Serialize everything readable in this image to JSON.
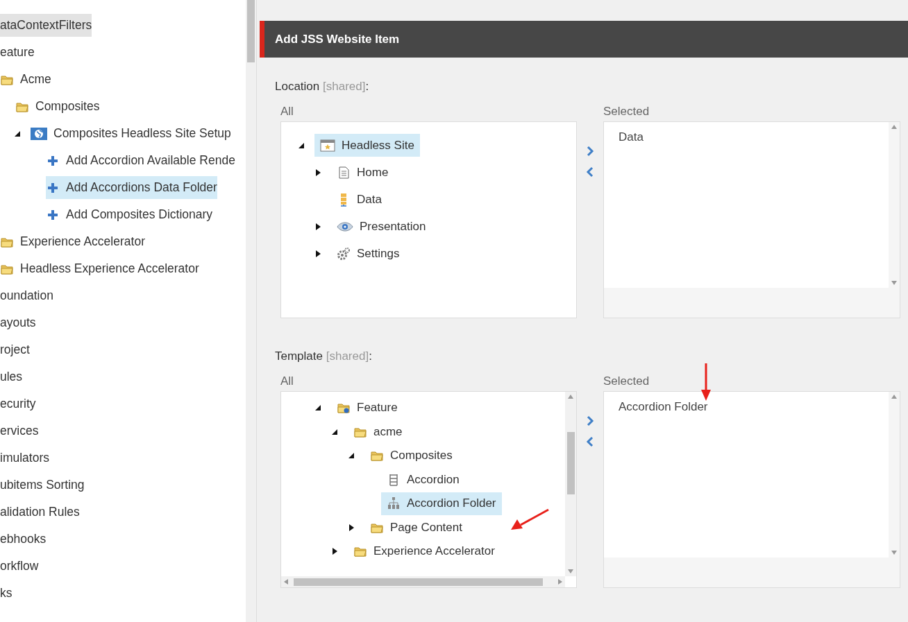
{
  "sidebar": {
    "tree": [
      {
        "label": "ataContextFilters",
        "selected": false,
        "hovered": true
      },
      {
        "label": "eature",
        "selected": false,
        "hovered": false,
        "children": [
          {
            "label": "Acme",
            "kind": "folder",
            "selected": false,
            "hovered": false,
            "children": [
              {
                "label": "Composites",
                "kind": "folder",
                "selected": false,
                "hovered": false,
                "children": [
                  {
                    "label": "Composites Headless Site Setup",
                    "kind": "globe",
                    "expanded": true,
                    "selected": false,
                    "hovered": false,
                    "children": [
                      {
                        "label": "Add Accordion Available Rende",
                        "kind": "plus",
                        "selected": false,
                        "hovered": false
                      },
                      {
                        "label": "Add Accordions Data Folder",
                        "kind": "plus",
                        "selected": true,
                        "hovered": false
                      },
                      {
                        "label": "Add Composites Dictionary",
                        "kind": "plus",
                        "selected": false,
                        "hovered": false
                      }
                    ]
                  }
                ]
              }
            ]
          },
          {
            "label": "Experience Accelerator",
            "kind": "folder",
            "selected": false,
            "hovered": false
          },
          {
            "label": "Headless Experience Accelerator",
            "kind": "folder",
            "selected": false,
            "hovered": false
          }
        ]
      },
      {
        "label": "oundation",
        "selected": false,
        "hovered": false
      },
      {
        "label": "ayouts",
        "selected": false,
        "hovered": false
      },
      {
        "label": "roject",
        "selected": false,
        "hovered": false
      },
      {
        "label": "ules",
        "selected": false,
        "hovered": false
      },
      {
        "label": "ecurity",
        "selected": false,
        "hovered": false
      },
      {
        "label": "ervices",
        "selected": false,
        "hovered": false
      },
      {
        "label": "imulators",
        "selected": false,
        "hovered": false
      },
      {
        "label": "ubitems Sorting",
        "selected": false,
        "hovered": false
      },
      {
        "label": "alidation Rules",
        "selected": false,
        "hovered": false
      },
      {
        "label": "ebhooks",
        "selected": false,
        "hovered": false
      },
      {
        "label": "orkflow",
        "selected": false,
        "hovered": false
      },
      {
        "label": "ks",
        "selected": false,
        "hovered": false
      }
    ]
  },
  "dialog": {
    "title": "Add JSS Website Item",
    "fields": [
      {
        "label": "Location",
        "note": "[shared]",
        "suffix": ":",
        "all_label": "All",
        "selected_label": "Selected",
        "tree": [
          {
            "label": "Headless Site",
            "kind": "site",
            "expanded": true,
            "selected": true,
            "children": [
              {
                "label": "Home",
                "kind": "page",
                "expanded": false,
                "selected": false
              },
              {
                "label": "Data",
                "kind": "data",
                "selected": false
              },
              {
                "label": "Presentation",
                "kind": "eye",
                "expanded": false,
                "selected": false
              },
              {
                "label": "Settings",
                "kind": "gear",
                "expanded": false,
                "selected": false
              }
            ]
          }
        ],
        "selected_items": [
          "Data"
        ]
      },
      {
        "label": "Template",
        "note": "[shared]",
        "suffix": ":",
        "all_label": "All",
        "selected_label": "Selected",
        "tree": [
          {
            "label": "Feature",
            "kind": "featurefolder",
            "expanded": true,
            "selected": false,
            "children": [
              {
                "label": "acme",
                "kind": "folder",
                "expanded": true,
                "selected": false,
                "children": [
                  {
                    "label": "Composites",
                    "kind": "folder",
                    "expanded": true,
                    "selected": false,
                    "children": [
                      {
                        "label": "Accordion",
                        "kind": "template",
                        "selected": false
                      },
                      {
                        "label": "Accordion Folder",
                        "kind": "hierarchy",
                        "selected": true
                      }
                    ]
                  },
                  {
                    "label": "Page Content",
                    "kind": "folder",
                    "expanded": false,
                    "selected": false
                  }
                ]
              },
              {
                "label": "Experience Accelerator",
                "kind": "folder",
                "expanded": false,
                "selected": false
              }
            ]
          }
        ],
        "selected_items": [
          "Accordion Folder"
        ]
      }
    ]
  }
}
